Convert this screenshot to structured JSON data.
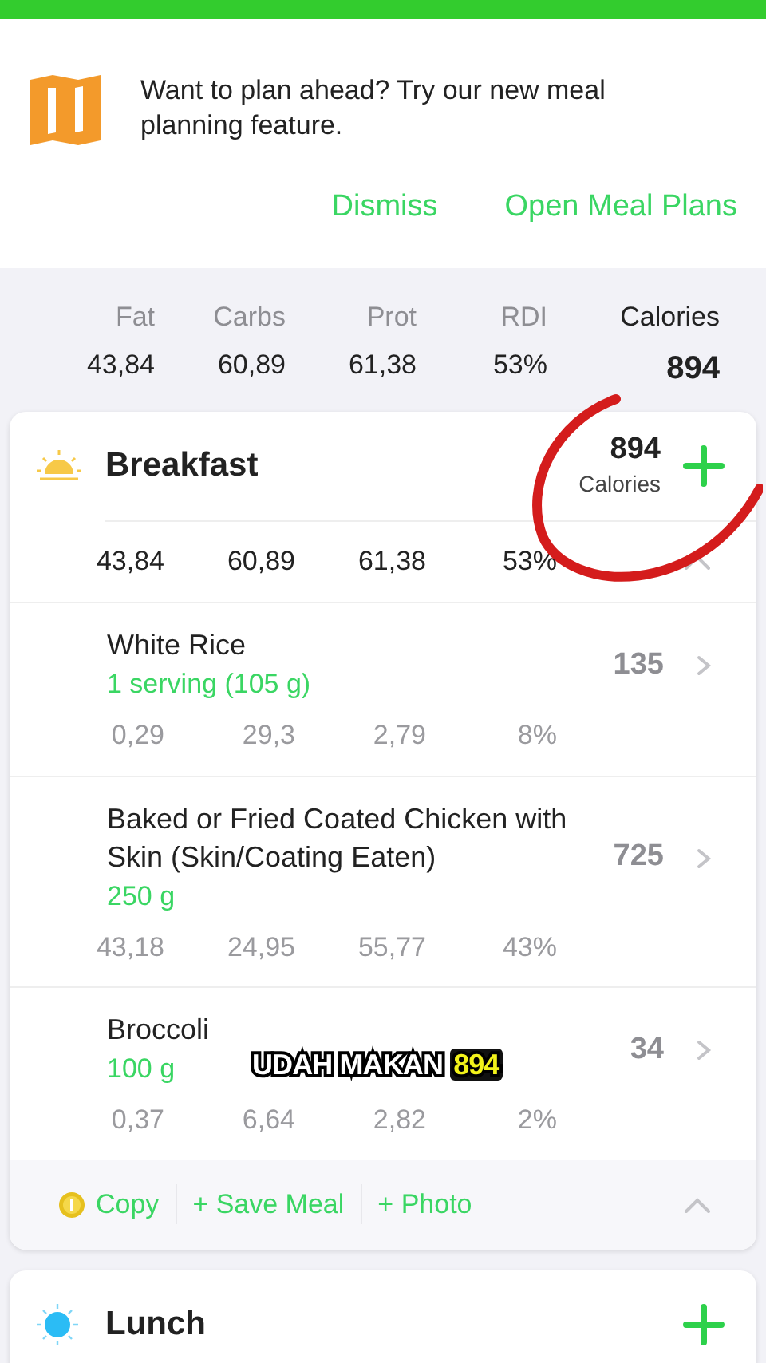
{
  "banner": {
    "text": "Want to plan ahead? Try our new meal planning feature.",
    "actions": [
      "Dismiss",
      "Open Meal Plans"
    ]
  },
  "summary": {
    "columns": [
      "Fat",
      "Carbs",
      "Prot",
      "RDI",
      "Calories"
    ],
    "values": [
      "43,84",
      "60,89",
      "61,38",
      "53%",
      "894"
    ]
  },
  "meals": [
    {
      "name": "Breakfast",
      "kind": "sunrise",
      "calories": "894",
      "calories_label": "Calories",
      "expanded": true,
      "totals": [
        "43,84",
        "60,89",
        "61,38",
        "53%"
      ],
      "foods": [
        {
          "name": "White Rice",
          "amount": "1 serving (105 g)",
          "calories": "135",
          "values": [
            "0,29",
            "29,3",
            "2,79",
            "8%"
          ]
        },
        {
          "name": "Baked or Fried Coated Chicken with Skin (Skin/Coating Eaten)",
          "amount": "250 g",
          "calories": "725",
          "values": [
            "43,18",
            "24,95",
            "55,77",
            "43%"
          ]
        },
        {
          "name": "Broccoli",
          "amount": "100 g",
          "calories": "34",
          "values": [
            "0,37",
            "6,64",
            "2,82",
            "2%"
          ]
        }
      ],
      "actions": [
        "Copy",
        "+ Save Meal",
        "+ Photo"
      ]
    },
    {
      "name": "Lunch",
      "kind": "sun",
      "expanded": false
    }
  ],
  "caption": {
    "text": "UDAH MAKAN",
    "highlight": "894"
  }
}
